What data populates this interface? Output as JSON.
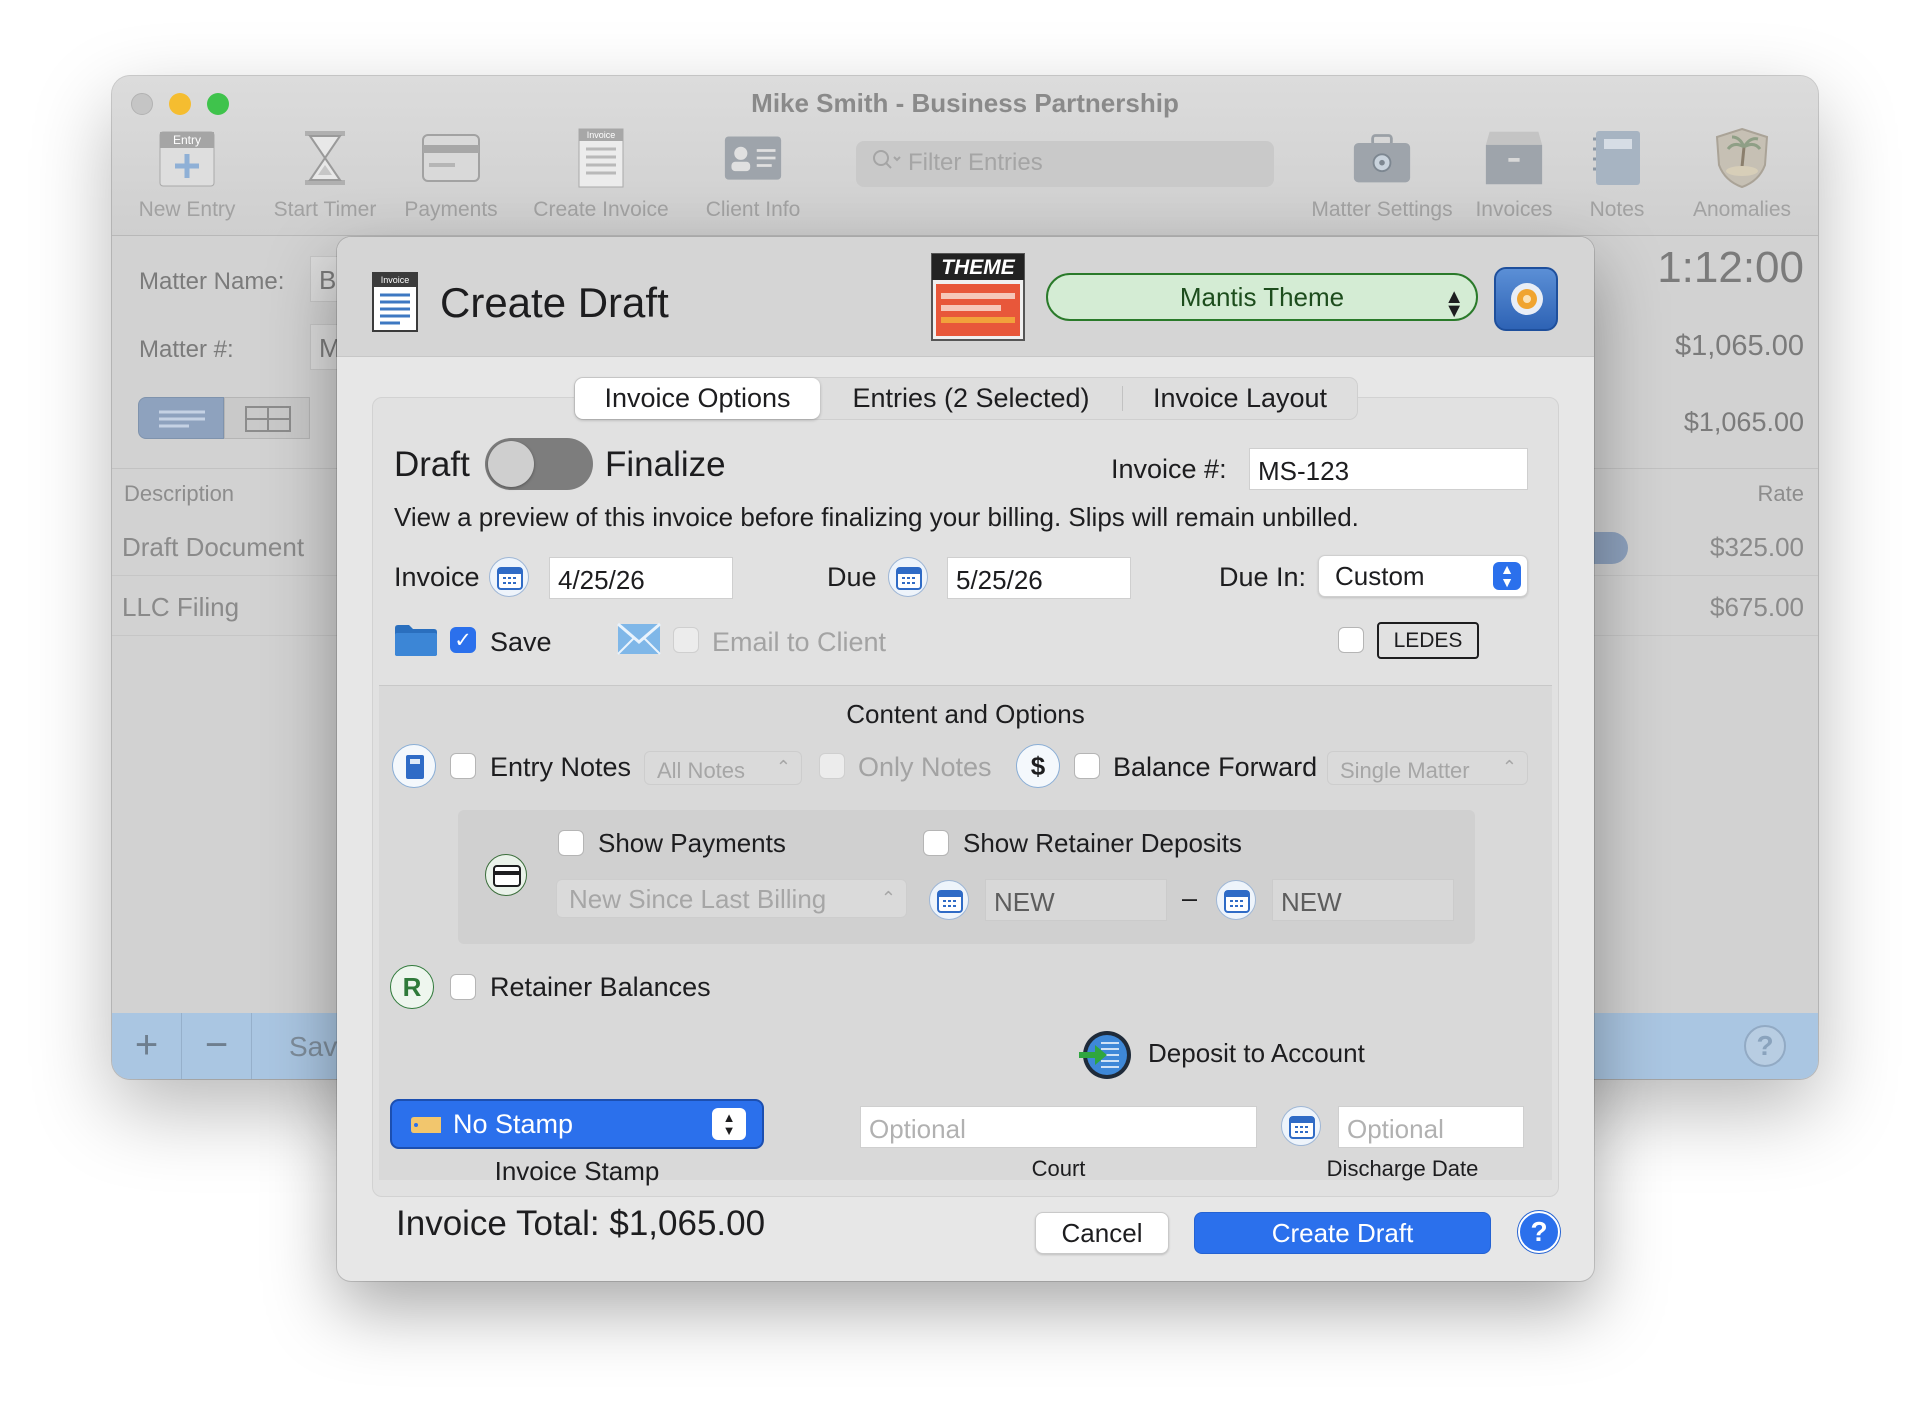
{
  "window": {
    "title": "Mike Smith - Business Partnership",
    "timer": "1:12:00",
    "toolbar": [
      {
        "label": "New Entry",
        "icon": "new-entry-icon",
        "badge": "Entry"
      },
      {
        "label": "Start Timer",
        "icon": "hourglass-icon"
      },
      {
        "label": "Payments",
        "icon": "credit-card-icon"
      },
      {
        "label": "Create Invoice",
        "icon": "invoice-icon",
        "badge": "Invoice"
      },
      {
        "label": "Client Info",
        "icon": "client-card-icon"
      },
      {
        "label": "Matter Settings",
        "icon": "briefcase-gear-icon"
      },
      {
        "label": "Invoices",
        "icon": "file-box-icon"
      },
      {
        "label": "Notes",
        "icon": "notebook-icon"
      },
      {
        "label": "Anomalies",
        "icon": "island-shield-icon"
      }
    ],
    "filter_placeholder": "Filter Entries",
    "matter_name_label": "Matter Name:",
    "matter_name_value": "B",
    "matter_num_label": "Matter #:",
    "matter_num_value": "M",
    "amount_1": "$1,065.00",
    "amount_2": "$1,065.00",
    "columns": {
      "description": "Description",
      "rate": "Rate"
    },
    "rows": [
      {
        "description": "Draft Document",
        "rate": "$325.00"
      },
      {
        "description": "LLC Filing",
        "rate": "$675.00"
      }
    ],
    "bottom": {
      "add": "+",
      "remove": "−",
      "save_partial": "Sav"
    }
  },
  "sheet": {
    "header_icon_badge": "Invoice",
    "title": "Create Draft",
    "theme_badge": "THEME",
    "theme_select": "Mantis Theme",
    "tabs": [
      "Invoice Options",
      "Entries (2 Selected)",
      "Invoice Layout"
    ],
    "draft_label": "Draft",
    "finalize_label": "Finalize",
    "invoice_num_label": "Invoice #:",
    "invoice_num_value": "MS-123",
    "description": "View a preview of this invoice before finalizing your billing. Slips will remain unbilled.",
    "invoice_date_label": "Invoice",
    "invoice_date": "4/25/26",
    "due_label": "Due",
    "due_date": "5/25/26",
    "due_in_label": "Due In:",
    "due_in_value": "Custom",
    "save_label": "Save",
    "save_checked": true,
    "email_label": "Email to Client",
    "ledes_label": "LEDES",
    "section_title": "Content and Options",
    "entry_notes_label": "Entry Notes",
    "notes_select": "All Notes",
    "only_notes_label": "Only Notes",
    "dollar_symbol": "$",
    "balance_forward_label": "Balance Forward",
    "matter_select": "Single Matter",
    "show_payments_label": "Show Payments",
    "show_retainer_label": "Show Retainer Deposits",
    "billing_select": "New Since Last Billing",
    "range_start": "NEW",
    "range_dash": "–",
    "range_end": "NEW",
    "retainer_symbol": "R",
    "retainer_balances_label": "Retainer Balances",
    "deposit_label": "Deposit to Account",
    "stamp_select": "No Stamp",
    "stamp_caption": "Invoice Stamp",
    "court_placeholder": "Optional",
    "court_caption": "Court",
    "discharge_placeholder": "Optional",
    "discharge_caption": "Discharge Date",
    "total": "Invoice Total: $1,065.00",
    "cancel_button": "Cancel",
    "create_button": "Create Draft",
    "help_symbol": "?"
  },
  "colors": {
    "accent": "#2b70ec",
    "theme_green": "#2a7a2a",
    "window_bg": "#d2d2d2"
  }
}
